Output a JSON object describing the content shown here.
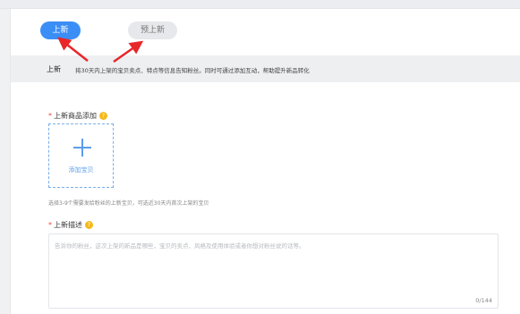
{
  "tabs": [
    {
      "label": "上新",
      "active": true
    },
    {
      "label": "预上新",
      "active": false
    }
  ],
  "info": {
    "label": "上新",
    "description": "将30天内上架的宝贝卖点、特点等信息告知粉丝。同时可通过添加互动，帮助提升新品转化"
  },
  "product_section": {
    "required_mark": "*",
    "title": "上新商品添加",
    "tip_icon": "help-icon",
    "add_label": "添加宝贝",
    "hint": "选择3-9个需要发给粉丝的上新宝贝，可选近30天内首次上架的宝贝"
  },
  "description_section": {
    "required_mark": "*",
    "title": "上新描述",
    "tip_icon": "help-icon",
    "placeholder": "告诉你的粉丝，这次上架的新品是哪些，宝贝的卖点、风格及使用体验或者你想对粉丝说的话等。",
    "counter": "0/144"
  },
  "colors": {
    "accent": "#3b8ef5",
    "arrow": "#e8262a",
    "required": "#f04a3c",
    "tip": "#f6b91b"
  }
}
